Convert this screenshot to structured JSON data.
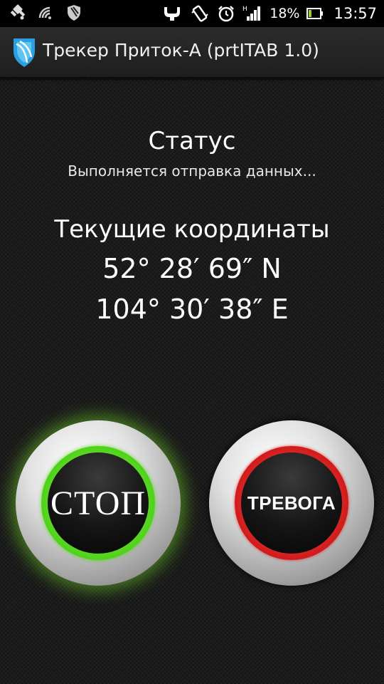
{
  "status_bar": {
    "battery_percent": "18%",
    "time": "13:57",
    "icons_left": [
      "location-icon",
      "wifi-icon",
      "shield-icon"
    ],
    "icons_right": [
      "usb-icon",
      "vibrate-icon",
      "alarm-icon",
      "signal-icon",
      "battery-icon"
    ]
  },
  "action_bar": {
    "title": "Трекер Приток-А (prtITAB 1.0)"
  },
  "content": {
    "status_heading": "Статус",
    "status_text": "Выполняется отправка данных...",
    "coords_heading": "Текущие координаты",
    "latitude": "52° 28′ 69″ N",
    "longitude": "104° 30′ 38″ E"
  },
  "buttons": {
    "stop_label": "СТОП",
    "alarm_label": "ТРЕВОГА"
  },
  "colors": {
    "stop_ring": "#4fd21a",
    "alarm_ring": "#d11b1b",
    "logo_blue": "#2aa0e0"
  }
}
